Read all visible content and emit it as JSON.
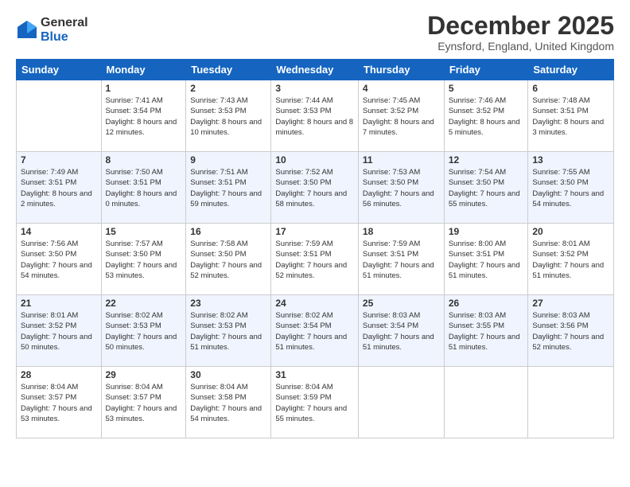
{
  "logo": {
    "general": "General",
    "blue": "Blue"
  },
  "header": {
    "month": "December 2025",
    "location": "Eynsford, England, United Kingdom"
  },
  "weekdays": [
    "Sunday",
    "Monday",
    "Tuesday",
    "Wednesday",
    "Thursday",
    "Friday",
    "Saturday"
  ],
  "weeks": [
    [
      {
        "day": "",
        "sunrise": "",
        "sunset": "",
        "daylight": ""
      },
      {
        "day": "1",
        "sunrise": "Sunrise: 7:41 AM",
        "sunset": "Sunset: 3:54 PM",
        "daylight": "Daylight: 8 hours and 12 minutes."
      },
      {
        "day": "2",
        "sunrise": "Sunrise: 7:43 AM",
        "sunset": "Sunset: 3:53 PM",
        "daylight": "Daylight: 8 hours and 10 minutes."
      },
      {
        "day": "3",
        "sunrise": "Sunrise: 7:44 AM",
        "sunset": "Sunset: 3:53 PM",
        "daylight": "Daylight: 8 hours and 8 minutes."
      },
      {
        "day": "4",
        "sunrise": "Sunrise: 7:45 AM",
        "sunset": "Sunset: 3:52 PM",
        "daylight": "Daylight: 8 hours and 7 minutes."
      },
      {
        "day": "5",
        "sunrise": "Sunrise: 7:46 AM",
        "sunset": "Sunset: 3:52 PM",
        "daylight": "Daylight: 8 hours and 5 minutes."
      },
      {
        "day": "6",
        "sunrise": "Sunrise: 7:48 AM",
        "sunset": "Sunset: 3:51 PM",
        "daylight": "Daylight: 8 hours and 3 minutes."
      }
    ],
    [
      {
        "day": "7",
        "sunrise": "Sunrise: 7:49 AM",
        "sunset": "Sunset: 3:51 PM",
        "daylight": "Daylight: 8 hours and 2 minutes."
      },
      {
        "day": "8",
        "sunrise": "Sunrise: 7:50 AM",
        "sunset": "Sunset: 3:51 PM",
        "daylight": "Daylight: 8 hours and 0 minutes."
      },
      {
        "day": "9",
        "sunrise": "Sunrise: 7:51 AM",
        "sunset": "Sunset: 3:51 PM",
        "daylight": "Daylight: 7 hours and 59 minutes."
      },
      {
        "day": "10",
        "sunrise": "Sunrise: 7:52 AM",
        "sunset": "Sunset: 3:50 PM",
        "daylight": "Daylight: 7 hours and 58 minutes."
      },
      {
        "day": "11",
        "sunrise": "Sunrise: 7:53 AM",
        "sunset": "Sunset: 3:50 PM",
        "daylight": "Daylight: 7 hours and 56 minutes."
      },
      {
        "day": "12",
        "sunrise": "Sunrise: 7:54 AM",
        "sunset": "Sunset: 3:50 PM",
        "daylight": "Daylight: 7 hours and 55 minutes."
      },
      {
        "day": "13",
        "sunrise": "Sunrise: 7:55 AM",
        "sunset": "Sunset: 3:50 PM",
        "daylight": "Daylight: 7 hours and 54 minutes."
      }
    ],
    [
      {
        "day": "14",
        "sunrise": "Sunrise: 7:56 AM",
        "sunset": "Sunset: 3:50 PM",
        "daylight": "Daylight: 7 hours and 54 minutes."
      },
      {
        "day": "15",
        "sunrise": "Sunrise: 7:57 AM",
        "sunset": "Sunset: 3:50 PM",
        "daylight": "Daylight: 7 hours and 53 minutes."
      },
      {
        "day": "16",
        "sunrise": "Sunrise: 7:58 AM",
        "sunset": "Sunset: 3:50 PM",
        "daylight": "Daylight: 7 hours and 52 minutes."
      },
      {
        "day": "17",
        "sunrise": "Sunrise: 7:59 AM",
        "sunset": "Sunset: 3:51 PM",
        "daylight": "Daylight: 7 hours and 52 minutes."
      },
      {
        "day": "18",
        "sunrise": "Sunrise: 7:59 AM",
        "sunset": "Sunset: 3:51 PM",
        "daylight": "Daylight: 7 hours and 51 minutes."
      },
      {
        "day": "19",
        "sunrise": "Sunrise: 8:00 AM",
        "sunset": "Sunset: 3:51 PM",
        "daylight": "Daylight: 7 hours and 51 minutes."
      },
      {
        "day": "20",
        "sunrise": "Sunrise: 8:01 AM",
        "sunset": "Sunset: 3:52 PM",
        "daylight": "Daylight: 7 hours and 51 minutes."
      }
    ],
    [
      {
        "day": "21",
        "sunrise": "Sunrise: 8:01 AM",
        "sunset": "Sunset: 3:52 PM",
        "daylight": "Daylight: 7 hours and 50 minutes."
      },
      {
        "day": "22",
        "sunrise": "Sunrise: 8:02 AM",
        "sunset": "Sunset: 3:53 PM",
        "daylight": "Daylight: 7 hours and 50 minutes."
      },
      {
        "day": "23",
        "sunrise": "Sunrise: 8:02 AM",
        "sunset": "Sunset: 3:53 PM",
        "daylight": "Daylight: 7 hours and 51 minutes."
      },
      {
        "day": "24",
        "sunrise": "Sunrise: 8:02 AM",
        "sunset": "Sunset: 3:54 PM",
        "daylight": "Daylight: 7 hours and 51 minutes."
      },
      {
        "day": "25",
        "sunrise": "Sunrise: 8:03 AM",
        "sunset": "Sunset: 3:54 PM",
        "daylight": "Daylight: 7 hours and 51 minutes."
      },
      {
        "day": "26",
        "sunrise": "Sunrise: 8:03 AM",
        "sunset": "Sunset: 3:55 PM",
        "daylight": "Daylight: 7 hours and 51 minutes."
      },
      {
        "day": "27",
        "sunrise": "Sunrise: 8:03 AM",
        "sunset": "Sunset: 3:56 PM",
        "daylight": "Daylight: 7 hours and 52 minutes."
      }
    ],
    [
      {
        "day": "28",
        "sunrise": "Sunrise: 8:04 AM",
        "sunset": "Sunset: 3:57 PM",
        "daylight": "Daylight: 7 hours and 53 minutes."
      },
      {
        "day": "29",
        "sunrise": "Sunrise: 8:04 AM",
        "sunset": "Sunset: 3:57 PM",
        "daylight": "Daylight: 7 hours and 53 minutes."
      },
      {
        "day": "30",
        "sunrise": "Sunrise: 8:04 AM",
        "sunset": "Sunset: 3:58 PM",
        "daylight": "Daylight: 7 hours and 54 minutes."
      },
      {
        "day": "31",
        "sunrise": "Sunrise: 8:04 AM",
        "sunset": "Sunset: 3:59 PM",
        "daylight": "Daylight: 7 hours and 55 minutes."
      },
      {
        "day": "",
        "sunrise": "",
        "sunset": "",
        "daylight": ""
      },
      {
        "day": "",
        "sunrise": "",
        "sunset": "",
        "daylight": ""
      },
      {
        "day": "",
        "sunrise": "",
        "sunset": "",
        "daylight": ""
      }
    ]
  ]
}
